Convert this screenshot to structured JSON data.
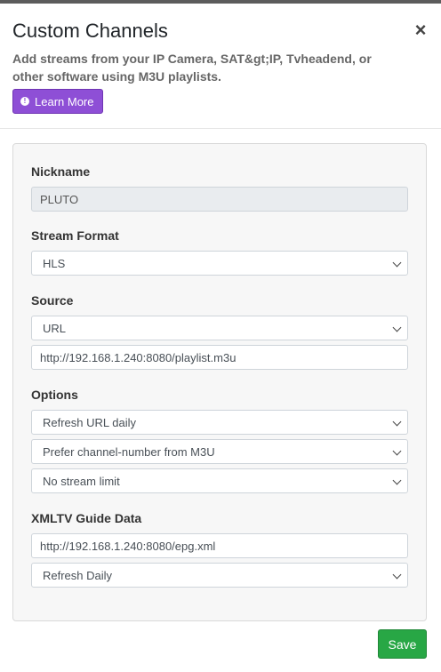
{
  "header": {
    "title": "Custom Channels",
    "close_glyph": "×",
    "subtitle": "Add streams from your IP Camera, SAT&gt;IP, Tvheadend, or other software using M3U playlists.",
    "learn_more_label": "Learn More",
    "learn_more_icon": "info-icon",
    "learn_more_color": "#8e4fd6"
  },
  "form": {
    "nickname": {
      "label": "Nickname",
      "value": "PLUTO"
    },
    "stream_format": {
      "label": "Stream Format",
      "selected": "HLS"
    },
    "source": {
      "label": "Source",
      "type_selected": "URL",
      "url_value": "http://192.168.1.240:8080/playlist.m3u"
    },
    "options": {
      "label": "Options",
      "refresh_selected": "Refresh URL daily",
      "channel_number_selected": "Prefer channel-number from M3U",
      "stream_limit_selected": "No stream limit"
    },
    "xmltv": {
      "label": "XMLTV Guide Data",
      "url_value": "http://192.168.1.240:8080/epg.xml",
      "refresh_selected": "Refresh Daily"
    }
  },
  "footer": {
    "save_label": "Save",
    "save_color": "#28a745"
  }
}
